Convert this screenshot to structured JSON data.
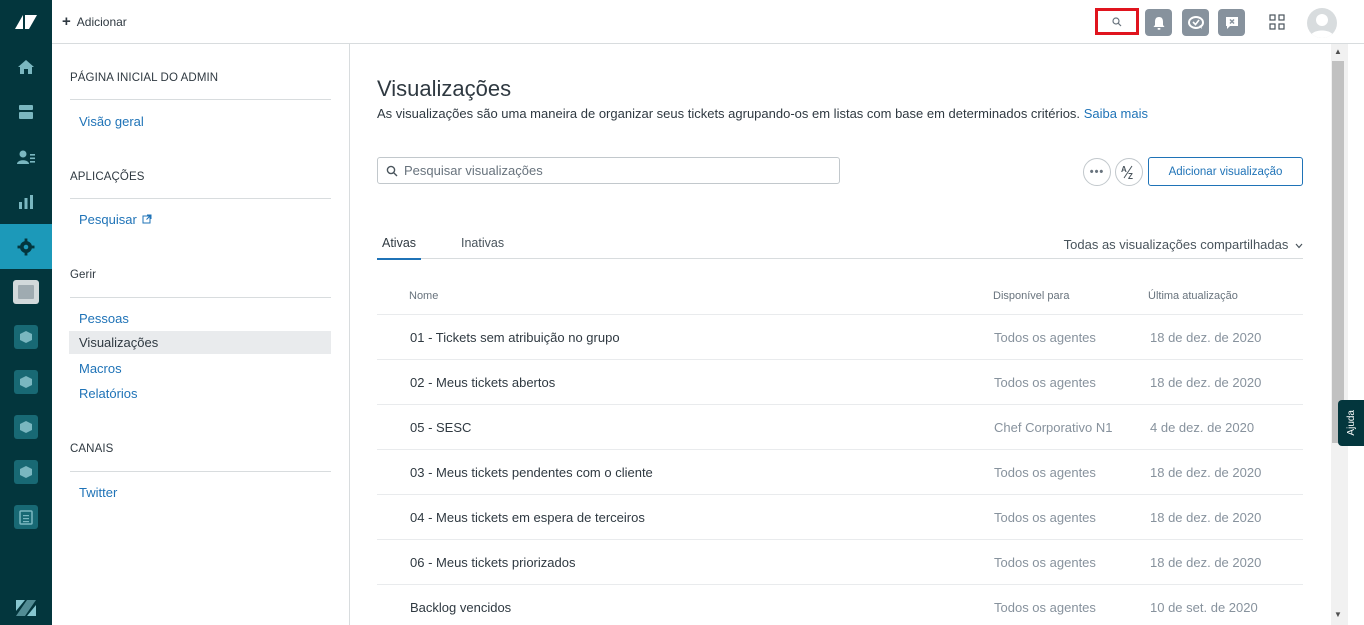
{
  "topbar": {
    "add_label": "Adicionar"
  },
  "rail": {
    "items": [
      {
        "name": "home-icon"
      },
      {
        "name": "views-icon"
      },
      {
        "name": "customers-icon"
      },
      {
        "name": "reporting-icon"
      },
      {
        "name": "admin-gear-icon"
      },
      {
        "name": "knowledge-icon"
      },
      {
        "name": "app-icon"
      },
      {
        "name": "app-icon"
      },
      {
        "name": "app-icon"
      },
      {
        "name": "app-icon"
      },
      {
        "name": "clipboard-icon"
      }
    ]
  },
  "sidenav": {
    "sections": [
      {
        "title": "PÁGINA INICIAL DO ADMIN",
        "links": [
          "Visão geral"
        ]
      },
      {
        "title": "APLICAÇÕES",
        "links": [
          "Pesquisar"
        ]
      },
      {
        "title": "Gerir",
        "links": [
          "Pessoas",
          "Visualizações",
          "Macros",
          "Relatórios"
        ]
      },
      {
        "title": "CANAIS",
        "links": [
          "Twitter"
        ]
      }
    ]
  },
  "main": {
    "title": "Visualizações",
    "description": "As visualizações são uma maneira de organizar seus tickets agrupando-os em listas com base em determinados critérios.",
    "learn_more": "Saiba mais",
    "search_placeholder": "Pesquisar visualizações",
    "add_view_label": "Adicionar visualização",
    "tabs": [
      "Ativas",
      "Inativas"
    ],
    "filter_label": "Todas as visualizações compartilhadas",
    "columns": {
      "name": "Nome",
      "available": "Disponível para",
      "updated": "Última atualização"
    },
    "rows": [
      {
        "name": "01 - Tickets sem atribuição no grupo",
        "available": "Todos os agentes",
        "updated": "18 de dez. de 2020"
      },
      {
        "name": "02 - Meus tickets abertos",
        "available": "Todos os agentes",
        "updated": "18 de dez. de 2020"
      },
      {
        "name": "05 - SESC",
        "available": "Chef Corporativo N1",
        "updated": "4 de dez. de 2020"
      },
      {
        "name": "03 - Meus tickets pendentes com o cliente",
        "available": "Todos os agentes",
        "updated": "18 de dez. de 2020"
      },
      {
        "name": "04 - Meus tickets em espera de terceiros",
        "available": "Todos os agentes",
        "updated": "18 de dez. de 2020"
      },
      {
        "name": "06 - Meus tickets priorizados",
        "available": "Todos os agentes",
        "updated": "18 de dez. de 2020"
      },
      {
        "name": "Backlog vencidos",
        "available": "Todos os agentes",
        "updated": "10 de set. de 2020"
      }
    ]
  },
  "help_tab": "Ajuda",
  "colors": {
    "rail": "#03363d",
    "link": "#1f73b7",
    "highlight": "#e0141e"
  }
}
